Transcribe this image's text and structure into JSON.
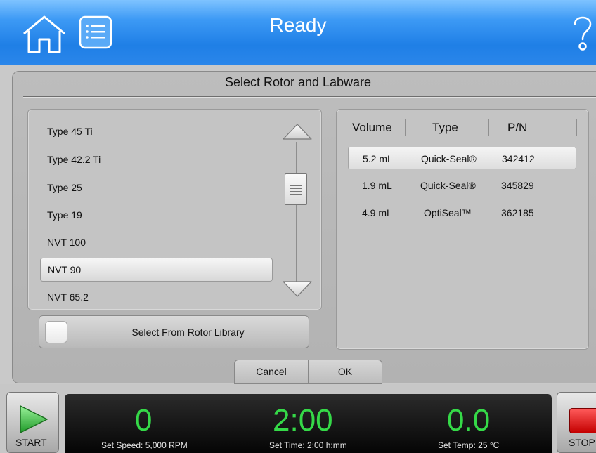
{
  "header": {
    "status": "Ready",
    "help_label": "?"
  },
  "dialog": {
    "title": "Select Rotor and Labware",
    "rotors": [
      "Type 45 Ti",
      "Type 42.2 Ti",
      "Type 25",
      "Type 19",
      "NVT 100",
      "NVT 90",
      "NVT 65.2"
    ],
    "selected_rotor": "NVT 90",
    "library_button": "Select From Rotor Library",
    "labware_headers": {
      "volume": "Volume",
      "type": "Type",
      "pn": "P/N"
    },
    "labware_rows": [
      {
        "volume": "5.2 mL",
        "type": "Quick-Seal®",
        "pn": "342412",
        "selected": true
      },
      {
        "volume": "1.9 mL",
        "type": "Quick-Seal®",
        "pn": "345829"
      },
      {
        "volume": "4.9 mL",
        "type": "OptiSeal™",
        "pn": "362185"
      }
    ],
    "cancel_label": "Cancel",
    "ok_label": "OK"
  },
  "controls": {
    "start_label": "START",
    "stop_label": "STOP"
  },
  "status": {
    "speed_value": "0",
    "speed_label": "Set Speed: 5,000 RPM",
    "time_value": "2:00",
    "time_label": "Set Time: 2:00 h:mm",
    "temp_value": "0.0",
    "temp_label": "Set Temp: 25 °C"
  },
  "colors": {
    "header_blue": "#1f7fe6",
    "readout_green": "#35d948",
    "stop_red": "#c40000",
    "start_green": "#2aa02a"
  }
}
